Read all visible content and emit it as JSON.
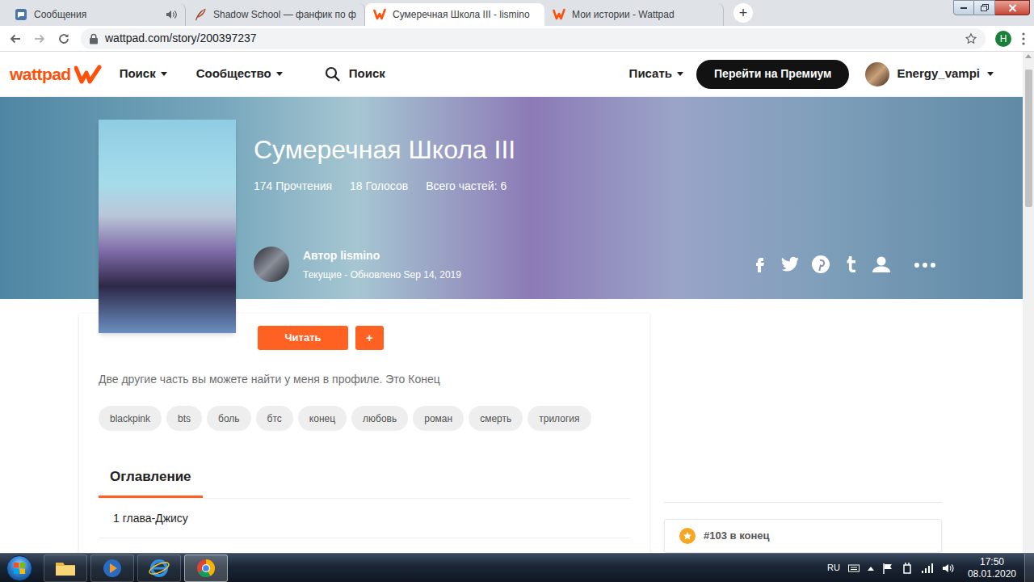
{
  "browser": {
    "tabs": [
      {
        "label": "Сообщения",
        "selected": false,
        "audio": true,
        "kind": "messages"
      },
      {
        "label": "Shadow School — фанфик по ф",
        "selected": false,
        "audio": false,
        "kind": "ficbook"
      },
      {
        "label": "Сумеречная Школа III - lismino",
        "selected": true,
        "audio": false,
        "kind": "wattpad"
      },
      {
        "label": "Мои истории - Wattpad",
        "selected": false,
        "audio": false,
        "kind": "wattpad"
      }
    ],
    "new_tab": "+",
    "address": "wattpad.com/story/200397237",
    "profile_initial": "H"
  },
  "header": {
    "logo": "wattpad",
    "nav": [
      "Поиск",
      "Сообщество"
    ],
    "search": "Поиск",
    "write": "Писать",
    "premium": "Перейти на Премиум",
    "username": "Energy_vampi"
  },
  "story": {
    "title": "Сумеречная Школа III",
    "stats": [
      "174 Прочтения",
      "18 Голосов",
      "Всего частей: 6"
    ],
    "author": "Автор lismino",
    "updated": "Текущие - Обновлено Sep 14, 2019",
    "read": "Читать",
    "add": "+",
    "description": "Две другие часть вы можете найти у меня в профиле. Это Конец",
    "tags": [
      "blackpink",
      "bts",
      "боль",
      "бтс",
      "конец",
      "любовь",
      "роман",
      "смерть",
      "трилогия"
    ],
    "toc_title": "Оглавление",
    "chapters": [
      "1 глава-Джису"
    ]
  },
  "ranking": {
    "text": "#103 в конец"
  },
  "taskbar": {
    "language": "RU",
    "time": "17:50",
    "date": "08.01.2020"
  }
}
